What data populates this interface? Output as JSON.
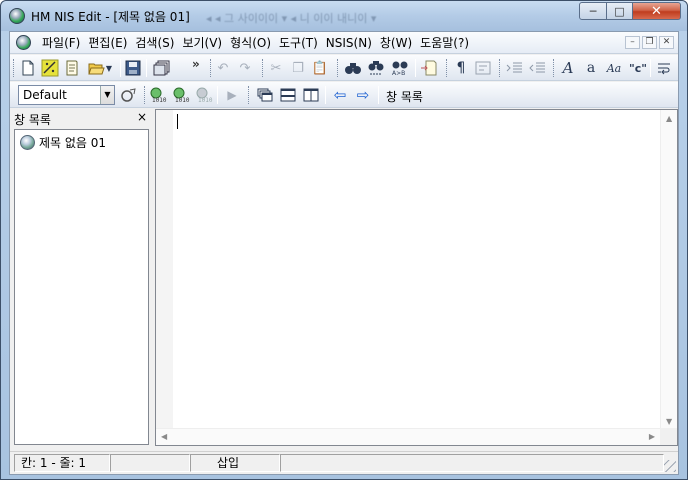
{
  "window": {
    "title": "HM NIS Edit - [제목 없음 01]",
    "title_ghost": "◂ ◂ 그 사이이이 ▾ ◂ 니 이이 내니이 ▾"
  },
  "menu": {
    "items": [
      "파일(F)",
      "편집(E)",
      "검색(S)",
      "보기(V)",
      "형식(O)",
      "도구(T)",
      "NSIS(N)",
      "창(W)",
      "도움말(?)"
    ]
  },
  "toolbar2": {
    "config_combo_value": "Default",
    "window_list_label": "창 목록"
  },
  "side_panel": {
    "title": "창 목록",
    "close_glyph": "×",
    "items": [
      {
        "label": "제목 없음 01"
      }
    ]
  },
  "statusbar": {
    "position": "칸: 1 - 줄: 1",
    "mode": "삽입"
  },
  "icons": {
    "new": "new-file-icon",
    "wizard": "wizard-icon",
    "template": "template-icon",
    "open": "open-folder-icon",
    "save": "save-icon",
    "save_all": "save-all-icon",
    "undo": "undo-icon",
    "redo": "redo-icon",
    "cut": "cut-icon",
    "copy": "copy-icon",
    "paste": "paste-icon",
    "find": "find-icon",
    "find_next": "find-next-icon",
    "replace": "replace-icon",
    "goto": "goto-line-icon",
    "whitespace": "show-whitespace-icon",
    "wordwrap": "word-wrap-icon",
    "indent": "indent-icon",
    "outdent": "outdent-icon",
    "font": "font-icon",
    "font_smaller": "font-lowercase-icon",
    "font_case": "change-case-icon",
    "quote": "quote-icon",
    "wrap_lines": "wrap-lines-icon"
  }
}
